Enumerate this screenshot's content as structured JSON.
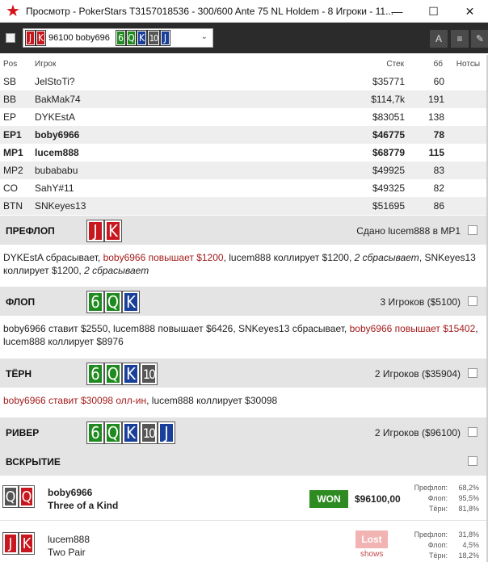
{
  "window": {
    "title": "Просмотр - PokerStars T3157018536 - 300/600 Ante 75 NL Holdem - 8 Игроки - 11...",
    "controls": [
      "—",
      "☐",
      "✕"
    ]
  },
  "toolbar": {
    "selected_hand": {
      "cards": [
        "J",
        "K"
      ],
      "label": "96100 boby696",
      "board": [
        "6",
        "Q",
        "K",
        "10",
        "J"
      ]
    },
    "icons": [
      "font-size-icon",
      "list-icon",
      "edit-icon"
    ],
    "icon_glyphs": [
      "A",
      "≡",
      "✎"
    ]
  },
  "table": {
    "headers": {
      "pos": "Pos",
      "player": "Игрок",
      "stack": "Стек",
      "bb": "бб",
      "notes": "Нотсы"
    },
    "rows": [
      {
        "pos": "SB",
        "name": "JelStoTi?",
        "stack": "$35771",
        "bb": "60",
        "bold": false
      },
      {
        "pos": "BB",
        "name": "BakMak74",
        "stack": "$114,7k",
        "bb": "191",
        "bold": false
      },
      {
        "pos": "EP",
        "name": "DYKEstA",
        "stack": "$83051",
        "bb": "138",
        "bold": false
      },
      {
        "pos": "EP1",
        "name": "boby6966",
        "stack": "$46775",
        "bb": "78",
        "bold": true
      },
      {
        "pos": "MP1",
        "name": "lucem888",
        "stack": "$68779",
        "bb": "115",
        "bold": true
      },
      {
        "pos": "MP2",
        "name": "bubababu",
        "stack": "$49925",
        "bb": "83",
        "bold": false
      },
      {
        "pos": "CO",
        "name": "SahY#11",
        "stack": "$49325",
        "bb": "82",
        "bold": false
      },
      {
        "pos": "BTN",
        "name": "SNKeyes13",
        "stack": "$51695",
        "bb": "86",
        "bold": false
      }
    ]
  },
  "streets": {
    "preflop": {
      "title": "ПРЕФЛОП",
      "cards": [
        "J",
        "K"
      ],
      "info": "Сдано lucem888 в MP1",
      "actions": [
        {
          "t": "DYKEstA сбрасывает, ",
          "s": ""
        },
        {
          "t": "boby6966 повышает $1200",
          "s": "red"
        },
        {
          "t": ", lucem888 коллирует $1200, ",
          "s": ""
        },
        {
          "t": "2 сбрасывает",
          "s": "it"
        },
        {
          "t": ", SNKeyes13 коллирует $1200, ",
          "s": ""
        },
        {
          "t": "2 сбрасывает",
          "s": "it"
        }
      ]
    },
    "flop": {
      "title": "ФЛОП",
      "cards": [
        "6",
        "Q",
        "K"
      ],
      "info": "3 Игроков ($5100)",
      "actions": [
        {
          "t": "boby6966 ставит $2550, lucem888 повышает $6426, SNKeyes13 сбрасывает, ",
          "s": ""
        },
        {
          "t": "boby6966 повышает $15402",
          "s": "red"
        },
        {
          "t": ", lucem888 коллирует $8976",
          "s": ""
        }
      ]
    },
    "turn": {
      "title": "ТЁРН",
      "cards": [
        "6",
        "Q",
        "K",
        "10"
      ],
      "info": "2 Игроков ($35904)",
      "actions": [
        {
          "t": "boby6966 ставит $30098 олл-ин",
          "s": "red"
        },
        {
          "t": ", lucem888 коллирует $30098",
          "s": ""
        }
      ]
    },
    "river": {
      "title": "РИВЕР",
      "cards": [
        "6",
        "Q",
        "K",
        "10",
        "J"
      ],
      "info": "2 Игроков ($96100)"
    },
    "showdown": {
      "title": "ВСКРЫТИЕ"
    }
  },
  "showdown_players": [
    {
      "cards": [
        "Q",
        "Q"
      ],
      "name": "boby6966",
      "hand": "Three of a Kind",
      "badge": "WON",
      "amount": "$96100,00",
      "equity": [
        {
          "k": "Префлоп:",
          "v": "68,2%"
        },
        {
          "k": "Флоп:",
          "v": "95,5%"
        },
        {
          "k": "Тёрн:",
          "v": "81,8%"
        }
      ]
    },
    {
      "cards": [
        "J",
        "K"
      ],
      "name": "lucem888",
      "hand": "Two Pair",
      "badge": "Lost",
      "shows": "shows",
      "equity": [
        {
          "k": "Префлоп:",
          "v": "31,8%"
        },
        {
          "k": "Флоп:",
          "v": "4,5%"
        },
        {
          "k": "Тёрн:",
          "v": "18,2%"
        }
      ]
    }
  ],
  "colors": {
    "toolbar_bg": "#2b2b2b",
    "section_bg": "#e4e4e4",
    "card_red": "#c8171e",
    "card_green": "#1f8a1f",
    "card_blue": "#1a3f9a",
    "card_gray": "#555555",
    "won_badge": "#2e8b22",
    "lost_badge": "#f2b3b3",
    "action_red": "#a31b1b"
  }
}
